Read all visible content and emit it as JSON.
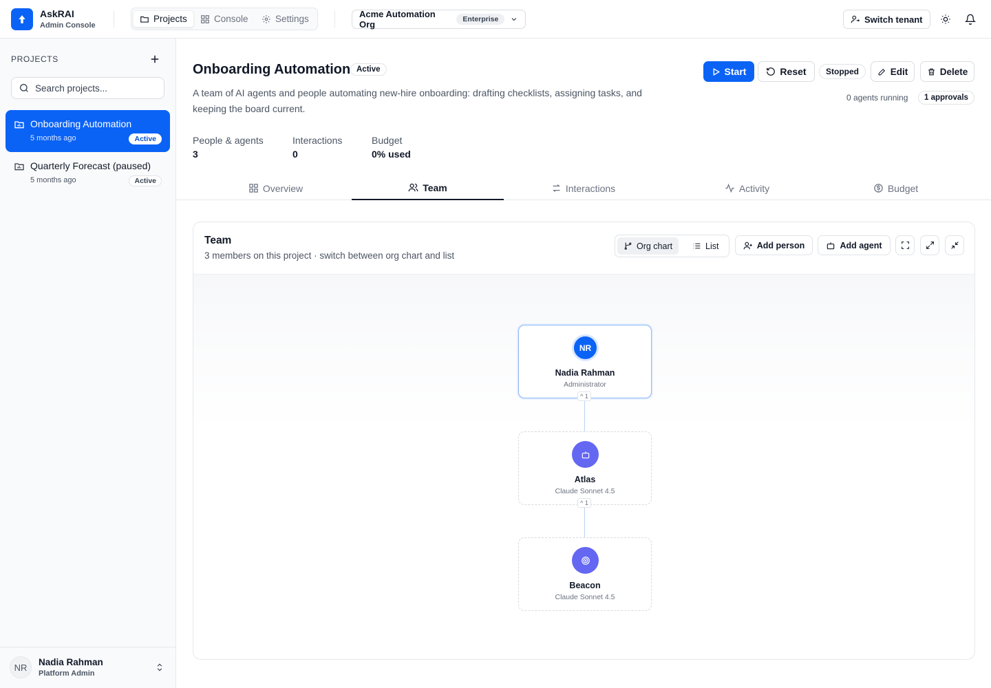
{
  "brand": {
    "name": "AskRAI",
    "subtitle": "Admin Console"
  },
  "nav": {
    "projects": "Projects",
    "console": "Console",
    "settings": "Settings"
  },
  "org": {
    "name": "Acme Automation Org",
    "plan": "Enterprise"
  },
  "header": {
    "switch_tenant": "Switch tenant"
  },
  "sidebar": {
    "title": "PROJECTS",
    "search_placeholder": "Search projects...",
    "projects": [
      {
        "name": "Onboarding Automation",
        "time": "5 months ago",
        "status": "Active"
      },
      {
        "name": "Quarterly Forecast (paused)",
        "time": "5 months ago",
        "status": "Active"
      }
    ],
    "user": {
      "initials": "NR",
      "name": "Nadia Rahman",
      "role": "Platform Admin"
    }
  },
  "project": {
    "title": "Onboarding Automation",
    "status": "Active",
    "description": "A team of AI agents and people automating new-hire onboarding: drafting checklists, assigning tasks, and keeping the board current.",
    "actions": {
      "start": "Start",
      "reset": "Reset",
      "stopped": "Stopped",
      "edit": "Edit",
      "delete": "Delete"
    },
    "running": "0 agents running",
    "approvals": "1 approvals",
    "stats": [
      {
        "label": "People & agents",
        "value": "3"
      },
      {
        "label": "Interactions",
        "value": "0"
      },
      {
        "label": "Budget",
        "value": "0% used"
      }
    ]
  },
  "tabs": [
    "Overview",
    "Team",
    "Interactions",
    "Activity",
    "Budget"
  ],
  "team": {
    "title": "Team",
    "subtitle": "3 members on this project · switch between org chart and list",
    "view_org": "Org chart",
    "view_list": "List",
    "add_person": "Add person",
    "add_agent": "Add agent",
    "nodes": [
      {
        "initials": "NR",
        "name": "Nadia Rahman",
        "role": "Administrator",
        "collapse": "^ 1"
      },
      {
        "name": "Atlas",
        "role": "Claude Sonnet 4.5",
        "collapse": "^ 1"
      },
      {
        "name": "Beacon",
        "role": "Claude Sonnet 4.5"
      }
    ]
  },
  "colors": {
    "accent": "#0b63f6",
    "agent": "#6467f2"
  }
}
